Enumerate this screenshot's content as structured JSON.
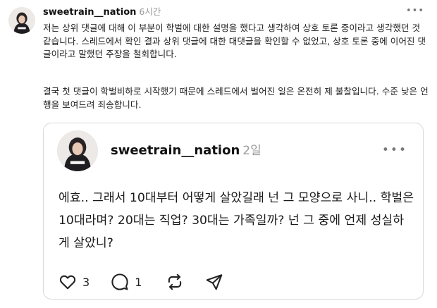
{
  "post": {
    "avatar_icon": "avatar-photo",
    "username": "sweetrain__nation",
    "time": "6시간",
    "more_icon": "more-icon",
    "paragraphs": [
      "저는 상위 댓글에 대해 이 부분이 학벌에 대한 설명을 했다고 생각하여 상호 토론 중이라고 생각했던 것 같습니다. 스레드에서 확인 결과 상위 댓글에 대한 대댓글을 확인할 수 없었고, 상호 토론 중에 이어진 댓글이라고 말했던 주장을 철회합니다.",
      "결국 첫 댓글이 학벌비하로 시작했기 때문에 스레드에서 벌어진 일은 온전히 제 불찰입니다. 수준 낮은 언행을 보여드려 죄송합니다."
    ]
  },
  "quoted": {
    "avatar_icon": "avatar-photo",
    "username": "sweetrain__nation",
    "time": "2일",
    "body": "에효.. 그래서 10대부터 어떻게 살았길래 넌 그 모양으로 사니.. 학벌은 10대라며? 20대는 직업? 30대는 가족일까? 넌 그 중에 언제 성실하게 살았니?",
    "actions": {
      "like_count": "3",
      "reply_count": "1",
      "like_icon": "heart-icon",
      "reply_icon": "comment-icon",
      "repost_icon": "repost-icon",
      "share_icon": "share-icon"
    }
  }
}
